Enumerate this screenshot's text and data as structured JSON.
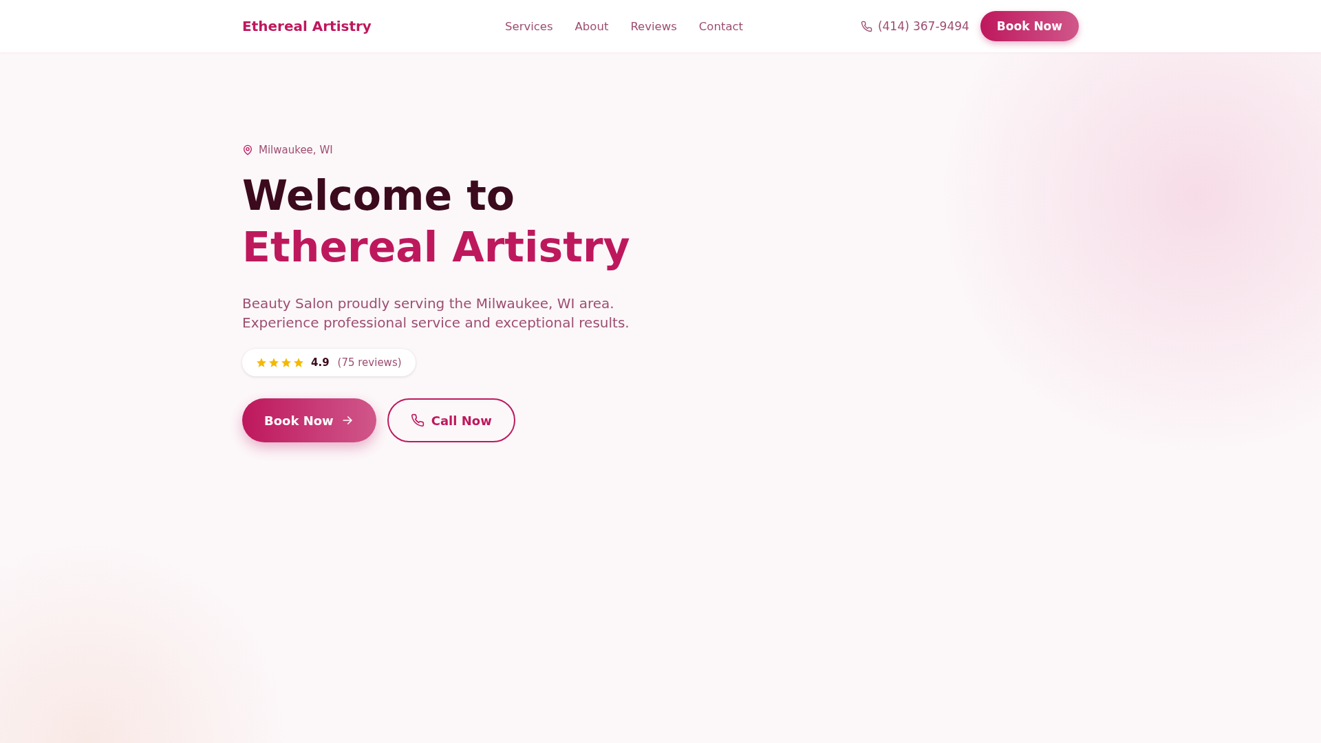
{
  "header": {
    "logo": "Ethereal Artistry",
    "nav": [
      "Services",
      "About",
      "Reviews",
      "Contact"
    ],
    "phone": "(414) 367-9494",
    "cta": "Book Now"
  },
  "hero": {
    "location": "Milwaukee, WI",
    "title_line_1": "Welcome to",
    "title_line_2": "Ethereal Artistry",
    "description": "Beauty Salon proudly serving the Milwaukee, WI area. Experience professional service and exceptional results.",
    "rating": {
      "stars": 4,
      "score": "4.9",
      "reviews": "(75 reviews)"
    },
    "primary_button": "Book Now",
    "secondary_button": "Call Now"
  }
}
